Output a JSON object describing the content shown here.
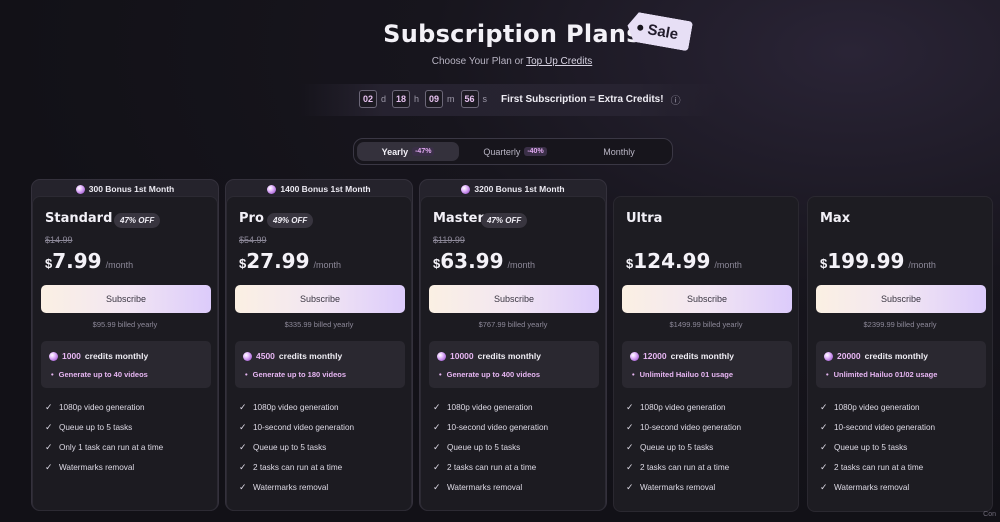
{
  "header": {
    "title": "Subscription Plans",
    "sale_tag": "Sale",
    "subtitle_prefix": "Choose Your Plan or ",
    "subtitle_link": "Top Up Credits"
  },
  "countdown": {
    "days": "02",
    "days_unit": "d",
    "hours": "18",
    "hours_unit": "h",
    "minutes": "09",
    "minutes_unit": "m",
    "seconds": "56",
    "seconds_unit": "s",
    "message": "First Subscription = Extra Credits!",
    "info_icon": "info-icon"
  },
  "billing": {
    "options": [
      {
        "label": "Yearly",
        "badge": "-47%",
        "active": true
      },
      {
        "label": "Quarterly",
        "badge": "-40%",
        "active": false
      },
      {
        "label": "Monthly",
        "badge": "",
        "active": false
      }
    ]
  },
  "plans": [
    {
      "bonus": "300 Bonus 1st Month",
      "name": "Standard",
      "off": "47% OFF",
      "old_price": "$14.99",
      "currency": "$",
      "price": "7.99",
      "per": "/month",
      "subscribe": "Subscribe",
      "billed": "$95.99 billed yearly",
      "credits_num": "1000",
      "credits_text": "credits monthly",
      "credits_sub": "Generate up to 40 videos",
      "features": [
        "1080p video generation",
        "Queue up to 5 tasks",
        "Only 1 task can run at a time",
        "Watermarks removal"
      ]
    },
    {
      "bonus": "1400 Bonus 1st Month",
      "name": "Pro",
      "off": "49% OFF",
      "old_price": "$54.99",
      "currency": "$",
      "price": "27.99",
      "per": "/month",
      "subscribe": "Subscribe",
      "billed": "$335.99 billed yearly",
      "credits_num": "4500",
      "credits_text": "credits monthly",
      "credits_sub": "Generate up to 180 videos",
      "features": [
        "1080p video generation",
        "10-second video generation",
        "Queue up to 5 tasks",
        "2 tasks can run at a time",
        "Watermarks removal"
      ]
    },
    {
      "bonus": "3200 Bonus 1st Month",
      "name": "Master",
      "off": "47% OFF",
      "old_price": "$119.99",
      "currency": "$",
      "price": "63.99",
      "per": "/month",
      "subscribe": "Subscribe",
      "billed": "$767.99 billed yearly",
      "credits_num": "10000",
      "credits_text": "credits monthly",
      "credits_sub": "Generate up to 400 videos",
      "features": [
        "1080p video generation",
        "10-second video generation",
        "Queue up to 5 tasks",
        "2 tasks can run at a time",
        "Watermarks removal"
      ]
    },
    {
      "name": "Ultra",
      "currency": "$",
      "price": "124.99",
      "per": "/month",
      "subscribe": "Subscribe",
      "billed": "$1499.99 billed yearly",
      "credits_num": "12000",
      "credits_text": "credits monthly",
      "credits_sub": "Unlimited Hailuo 01 usage",
      "features": [
        "1080p video generation",
        "10-second video generation",
        "Queue up to 5 tasks",
        "2 tasks can run at a time",
        "Watermarks removal"
      ]
    },
    {
      "name": "Max",
      "currency": "$",
      "price": "199.99",
      "per": "/month",
      "subscribe": "Subscribe",
      "billed": "$2399.99 billed yearly",
      "credits_num": "20000",
      "credits_text": "credits monthly",
      "credits_sub": "Unlimited Hailuo 01/02 usage",
      "features": [
        "1080p video generation",
        "10-second video generation",
        "Queue up to 5 tasks",
        "2 tasks can run at a time",
        "Watermarks removal"
      ]
    }
  ],
  "corner_text": "Con"
}
